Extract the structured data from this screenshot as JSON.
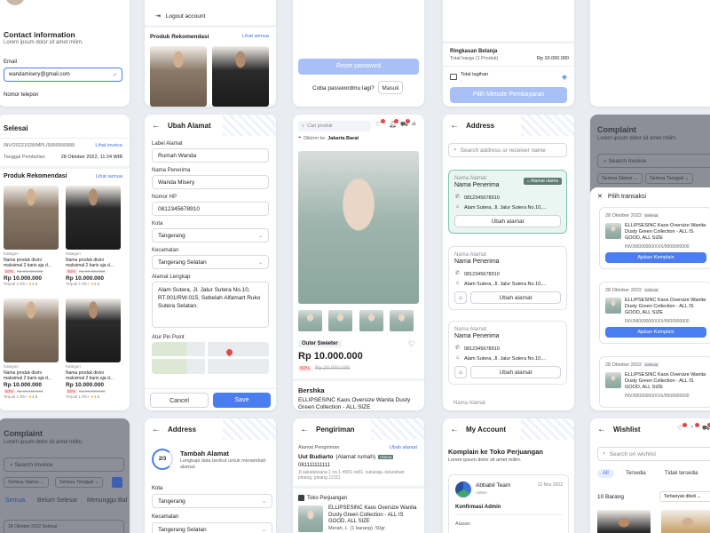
{
  "card1": {
    "contact_title": "Contact information",
    "contact_sub": "Lorem ipsum dolor sit amet milim.",
    "email_label": "Email",
    "email_value": "wandamisery@gmail.com",
    "phone_label": "Nomor telepon"
  },
  "card2": {
    "logout": "Logout account",
    "rec_title": "Produk Rekomendasi",
    "see_all": "Lihat semua"
  },
  "card3": {
    "reset_btn": "Reset password",
    "forgot_q": "Coba passwordmu lagi?",
    "login_btn": "Masuk"
  },
  "card4": {
    "summary_title": "Ringkasan Belanja",
    "total_label": "Total harga (1 Produk)",
    "total_value": "Rp 10.000.000",
    "bill_label": "Total tagihan",
    "bill_value": "-",
    "pay_btn": "Pilih Metode Pembayaran"
  },
  "card6": {
    "title": "Selesai",
    "invoice": "INV/20221028/MPL/9999999999",
    "invoice_link": "Lihat invoice",
    "date_label": "Tanggal Pembelian",
    "date_value": "28 Oktober 2022, 11:24 WIB",
    "rec_title": "Produk Rekomendasi",
    "see_all": "Lihat semua",
    "product": {
      "kategori": "Kategori",
      "name": "Nama produk disini maksimal 2 baris aja d...",
      "discount": "50%",
      "old_price": "Rp 00.000.000",
      "price": "Rp 10.000.000",
      "sold": "Terjual 1 Rb+",
      "rating": "4.8"
    }
  },
  "card7": {
    "title": "Ubah Alamat",
    "label_label": "Label Alamat",
    "label_value": "Rumah Wanda",
    "receiver_label": "Nama Penerima",
    "receiver_value": "Wanda Misery",
    "phone_label": "Nomor HP",
    "phone_value": "0812345678910",
    "city_label": "Kota",
    "city_value": "Tangerang",
    "district_label": "Kecamatan",
    "district_value": "Tangerang Selatan",
    "full_label": "Alamat Lengkap",
    "full_value": "Alam Sutera, Jl. Jalur Sutera No.10, RT.001/RW.015, Sebelah Alfamart Ruko Sutera Selatan.",
    "pin_label": "Atur Pin Point",
    "cancel_btn": "Cancel",
    "save_btn": "Save"
  },
  "card8": {
    "search_placeholder": "Cari produk",
    "ship_to": "Dikirim ke",
    "ship_city": "Jakarta Barat",
    "badge": "Outer Sweeter",
    "price": "Rp 10.000.000",
    "discount": "50%",
    "old_price": "Rp 20.000.000",
    "brand": "Bershka",
    "desc": "ELLIPSESINC Kaos Oversize Wanita Dusty Green Collection - ALL SIZE"
  },
  "card9": {
    "title": "Address",
    "search_placeholder": "Search address or receiver name",
    "label_name": "Nama Alamat",
    "main_badge": "Alamat utama",
    "receiver": "Nama Penerima",
    "phone": "0812345678910",
    "addr": "Alam Sutera, Jl. Jalur Sutera No.10,...",
    "change_btn": "Ubah alamat"
  },
  "card10": {
    "title": "Complaint",
    "sub": "Lorem ipsum dolor sit amet milim.",
    "search_placeholder": "Search Invoice",
    "f1": "Semua Status",
    "f2": "Semua Tanggal",
    "sheet_title": "Pilih transaksi",
    "trx_date": "28 Oktober 2022",
    "trx_status": "Selesai",
    "trx_name": "ELLIPSESINC Kaos Oversize Wanita Dusty Green Collection - ALL IS GOOD, ALL SIZE",
    "trx_inv": "INV/00000000/XXX/0000000000",
    "trx_btn": "Ajukan Komplain"
  },
  "card11": {
    "title": "Complaint",
    "sub": "Lorem ipsum dolor sit amet milim.",
    "search_placeholder": "Search Invoice",
    "f1": "Semua Status",
    "f2": "Semua Tanggal",
    "tabs": [
      "Semua",
      "Belum Selesai",
      "Menunggu Bal"
    ],
    "date": "28 Oktober 2022",
    "status": "Selesai"
  },
  "card12": {
    "title": "Address",
    "step": "2/3",
    "add_title": "Tambah Alamat",
    "add_sub": "Lengkapi data berikut untuk menambah alamat.",
    "city_label": "Kota",
    "city_value": "Tangerang",
    "district_label": "Kecamatan",
    "district_value": "Tangerang Selatan"
  },
  "card13": {
    "title": "Pengiriman",
    "ship_addr_label": "Alamat Pengiriman",
    "change_link": "Ubah alamat",
    "receiver": "Uut Budiarto",
    "receiver_tag": "(Alamat rumah)",
    "utama": "Utama",
    "phone": "081111111111",
    "addr_line": "Jl.sukalaksana 1 no.1 rt001 rw01, sukaraja, kelurahan pinang, pinang 12111",
    "store": "Toko Perjuangan",
    "item_name": "ELLIPSESINC Kaos Oversize Wanita Dusty Green Collection - ALL IS GOOD, ALL SIZE",
    "item_meta": "Merah, L  (1 barang)  50gr"
  },
  "card14": {
    "title": "My Account",
    "heading": "Komplain ke Toko Perjuangan",
    "sub": "Lorem ipsum dolor sit amet milim.",
    "team": "Abbabil Team",
    "team_sub": "Admin",
    "date": "12 Nov 2022",
    "subject": "Konfirmasi Admin",
    "body": "Alasan"
  },
  "card15": {
    "title": "Wishlist",
    "search_placeholder": "Search on wishlist",
    "tabs": [
      "All",
      "Tersedia",
      "Tidak tersedia"
    ],
    "count": "10 Barang",
    "sort": "Terbanyak dibeli"
  }
}
